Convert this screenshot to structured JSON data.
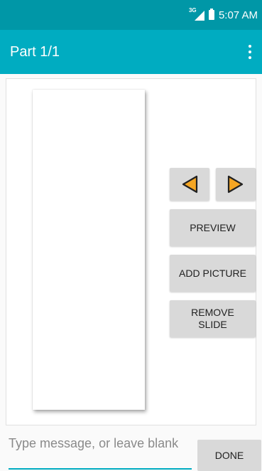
{
  "status_bar": {
    "network_label": "3G",
    "time": "5:07 AM",
    "icons": [
      "signal-icon",
      "battery-icon"
    ]
  },
  "app_bar": {
    "title": "Part 1/1",
    "menu_icon": "overflow-menu-icon"
  },
  "slide_controls": {
    "prev_icon": "previous-arrow-icon",
    "next_icon": "next-arrow-icon",
    "preview_label": "PREVIEW",
    "add_picture_label": "ADD PICTURE",
    "remove_slide_label": "REMOVE\nSLIDE"
  },
  "compose": {
    "placeholder": "Type message, or leave blank",
    "done_label": "DONE"
  },
  "colors": {
    "status_bar": "#0097a7",
    "app_bar": "#00acc1",
    "button_bg": "#d9d9d9",
    "arrow_fill": "#f5a623"
  }
}
